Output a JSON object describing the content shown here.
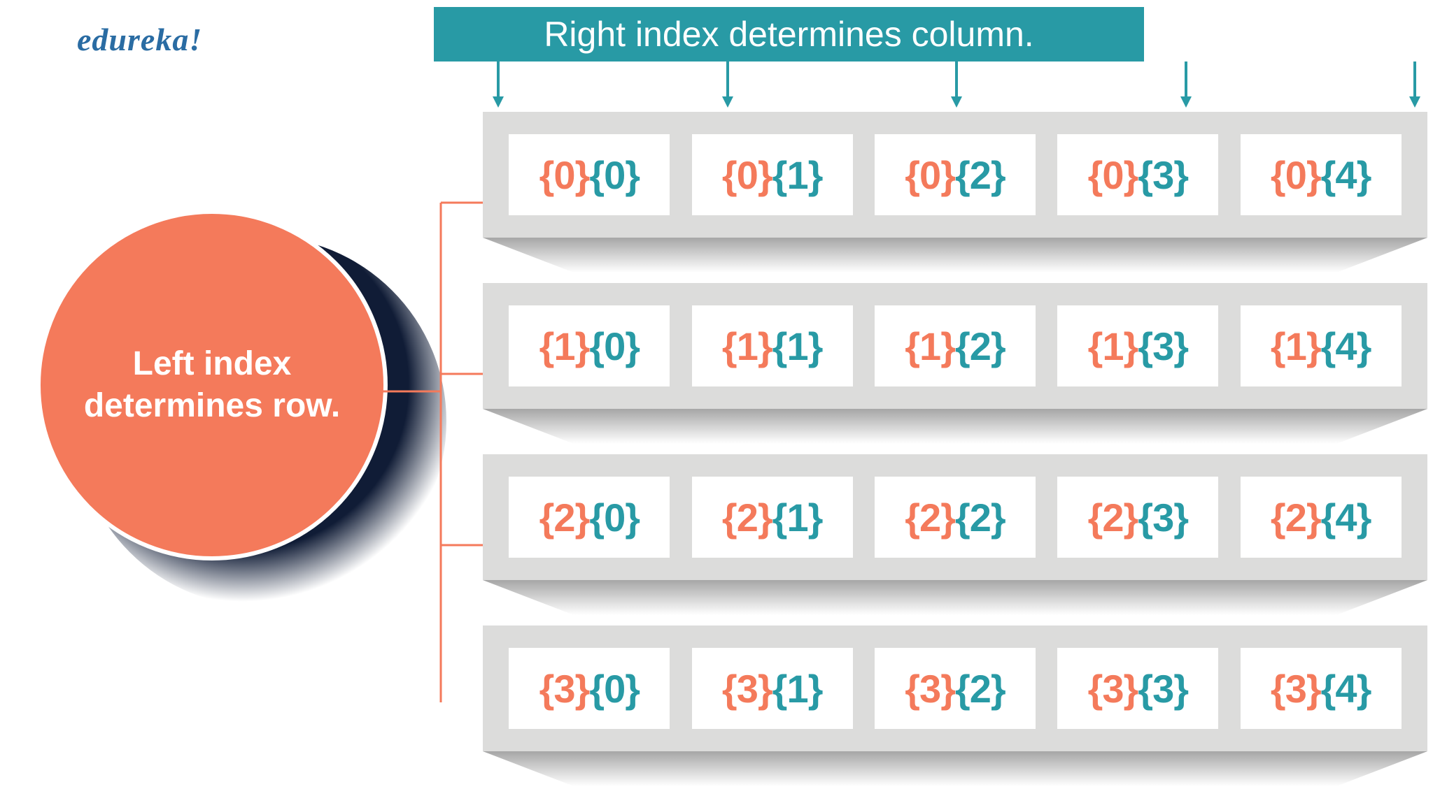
{
  "logo": "edureka!",
  "banner": "Right index determines column.",
  "circle_text": "Left index determines row.",
  "colors": {
    "row_brace": "#f47a5b",
    "col_brace": "#289aa5",
    "row_bg": "#dcdcdb",
    "banner_bg": "#289aa5",
    "circle_bg": "#f47a5b",
    "logo_color": "#2a6ca3"
  },
  "grid": {
    "rows": 4,
    "cols": 5,
    "row_indices": [
      0,
      1,
      2,
      3
    ],
    "col_indices": [
      0,
      1,
      2,
      3,
      4
    ]
  }
}
